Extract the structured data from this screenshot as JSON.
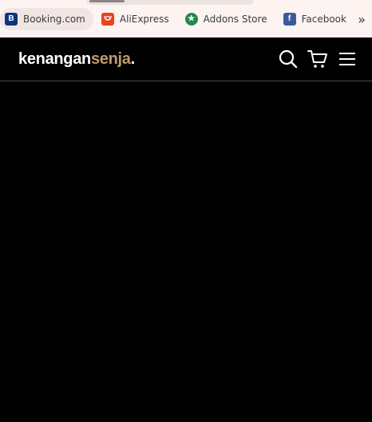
{
  "bookmarks": {
    "items": [
      {
        "label": "Booking.com",
        "favicon_text": "B",
        "icon": "booking-favicon",
        "color": "#0a3580"
      },
      {
        "label": "AliExpress",
        "favicon_text": "",
        "icon": "aliexpress-favicon",
        "color": "#e8431a"
      },
      {
        "label": "Addons Store",
        "favicon_text": "★",
        "icon": "addons-store-favicon",
        "color": "#1f8a4c"
      },
      {
        "label": "Facebook",
        "favicon_text": "f",
        "icon": "facebook-favicon",
        "color": "#3c5a99"
      }
    ],
    "overflow_glyph": "»"
  },
  "site": {
    "logo_part1": "kenangan",
    "logo_part2": "senja",
    "logo_dot": ".",
    "accent_color": "#c09a6b",
    "icons": [
      "search-icon",
      "cart-icon",
      "menu-icon"
    ]
  }
}
